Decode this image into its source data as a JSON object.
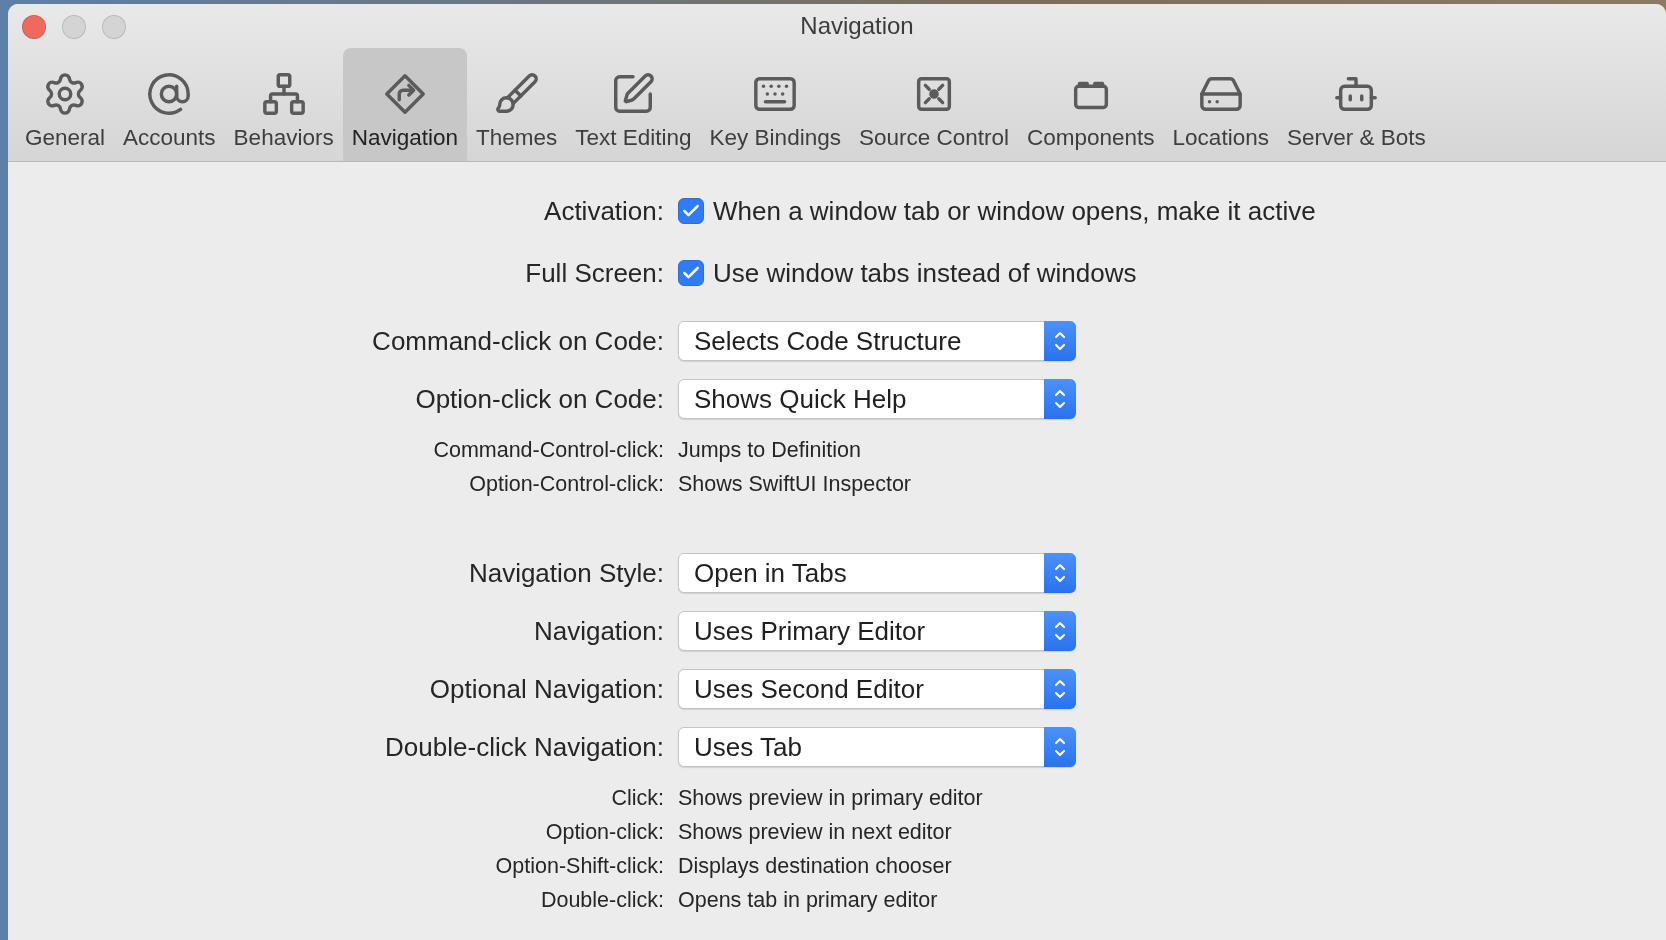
{
  "window": {
    "title": "Navigation"
  },
  "toolbar": [
    {
      "label": "General",
      "selected": false
    },
    {
      "label": "Accounts",
      "selected": false
    },
    {
      "label": "Behaviors",
      "selected": false
    },
    {
      "label": "Navigation",
      "selected": true
    },
    {
      "label": "Themes",
      "selected": false
    },
    {
      "label": "Text Editing",
      "selected": false
    },
    {
      "label": "Key Bindings",
      "selected": false
    },
    {
      "label": "Source Control",
      "selected": false
    },
    {
      "label": "Components",
      "selected": false
    },
    {
      "label": "Locations",
      "selected": false
    },
    {
      "label": "Server & Bots",
      "selected": false
    }
  ],
  "settings": [
    {
      "kind": "checkbox",
      "label": "Activation:",
      "text": "When a window tab or window opens, make it active",
      "checked": true
    },
    {
      "kind": "checkbox",
      "label": "Full Screen:",
      "text": "Use window tabs instead of windows",
      "checked": true
    },
    {
      "kind": "popup",
      "label": "Command-click on Code:",
      "value": "Selects Code Structure"
    },
    {
      "kind": "popup",
      "label": "Option-click on Code:",
      "value": "Shows Quick Help"
    },
    {
      "kind": "info",
      "label": "Command-Control-click:",
      "value": "Jumps to Definition"
    },
    {
      "kind": "info",
      "label": "Option-Control-click:",
      "value": "Shows SwiftUI Inspector"
    },
    {
      "kind": "popup",
      "label": "Navigation Style:",
      "value": "Open in Tabs"
    },
    {
      "kind": "popup",
      "label": "Navigation:",
      "value": "Uses Primary Editor"
    },
    {
      "kind": "popup",
      "label": "Optional Navigation:",
      "value": "Uses Second Editor"
    },
    {
      "kind": "popup",
      "label": "Double-click Navigation:",
      "value": "Uses Tab"
    },
    {
      "kind": "info",
      "label": "Click:",
      "value": "Shows preview in primary editor"
    },
    {
      "kind": "info",
      "label": "Option-click:",
      "value": "Shows preview in next editor"
    },
    {
      "kind": "info",
      "label": "Option-Shift-click:",
      "value": "Displays destination chooser"
    },
    {
      "kind": "info",
      "label": "Double-click:",
      "value": "Opens tab in primary editor"
    }
  ]
}
